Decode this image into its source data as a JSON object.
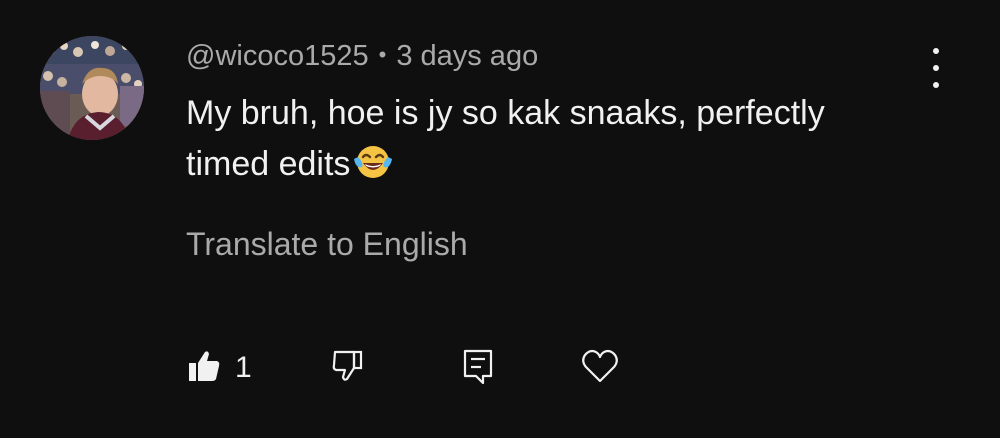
{
  "comment": {
    "author": "@wicoco1525",
    "separator": "•",
    "timestamp": "3 days ago",
    "text": "My bruh, hoe is jy so kak snaaks, perfectly timed edits",
    "emoji": "face-with-tears-of-joy",
    "translate_label": "Translate to English",
    "like_count": "1"
  },
  "icons": {
    "more": "more-vertical-icon",
    "like": "thumbs-up-icon",
    "dislike": "thumbs-down-icon",
    "reply": "reply-comment-icon",
    "heart": "heart-icon"
  },
  "colors": {
    "background": "#0f0f0f",
    "primary_text": "#f1f1f1",
    "secondary_text": "#aaaaaa"
  }
}
